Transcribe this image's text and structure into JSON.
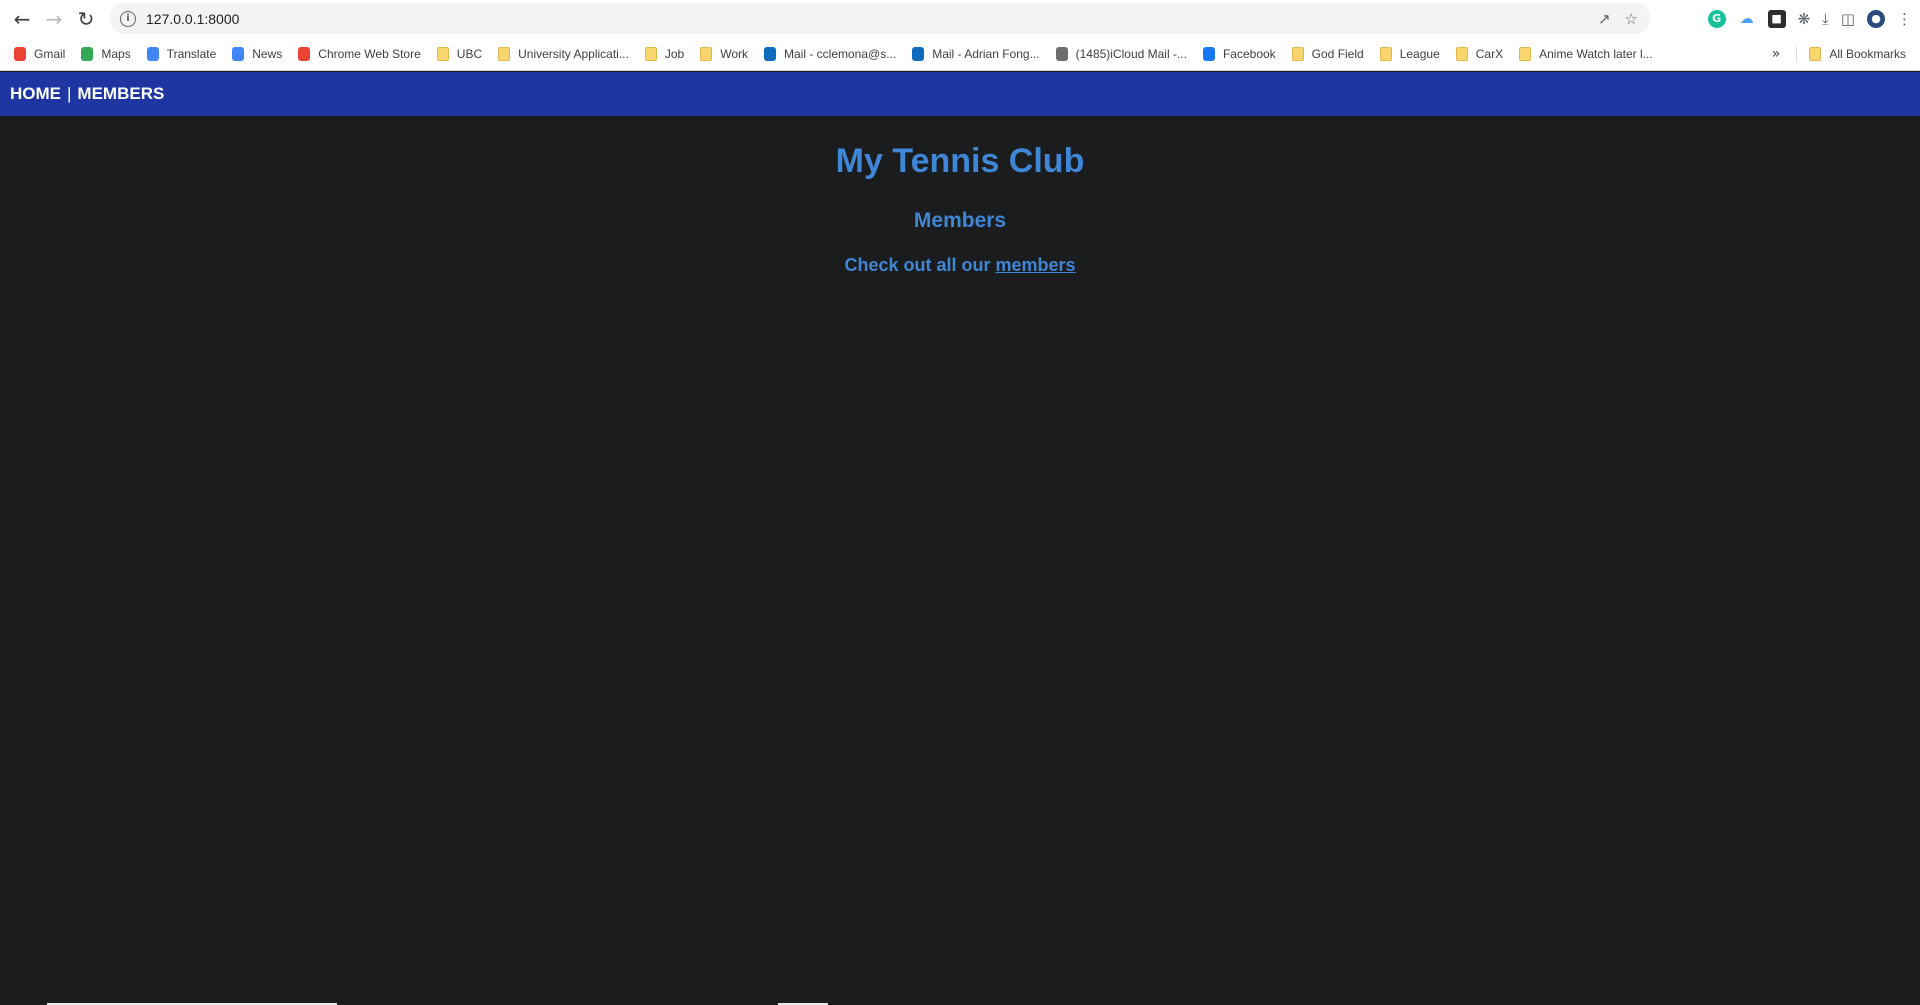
{
  "browser": {
    "url": "127.0.0.1:8000",
    "bookmarks": [
      {
        "label": "Gmail",
        "icon": "gmail-icon",
        "color": "#ea4335"
      },
      {
        "label": "Maps",
        "icon": "maps-icon",
        "color": "#34a853"
      },
      {
        "label": "Translate",
        "icon": "translate-icon",
        "color": "#4285f4"
      },
      {
        "label": "News",
        "icon": "news-icon",
        "color": "#4285f4"
      },
      {
        "label": "Chrome Web Store",
        "icon": "webstore-icon",
        "color": "#ea4335"
      },
      {
        "label": "UBC",
        "icon": "folder-icon",
        "color": "#f9d56e"
      },
      {
        "label": "University Applicati...",
        "icon": "folder-icon",
        "color": "#f9d56e"
      },
      {
        "label": "Job",
        "icon": "folder-icon",
        "color": "#f9d56e"
      },
      {
        "label": "Work",
        "icon": "folder-icon",
        "color": "#f9d56e"
      },
      {
        "label": "Mail - cclemona@s...",
        "icon": "outlook-icon",
        "color": "#0f6cbd"
      },
      {
        "label": "Mail - Adrian Fong...",
        "icon": "outlook-icon",
        "color": "#0f6cbd"
      },
      {
        "label": "(1485)iCloud Mail -...",
        "icon": "apple-icon",
        "color": "#6e6e6e"
      },
      {
        "label": "Facebook",
        "icon": "facebook-icon",
        "color": "#1877f2"
      },
      {
        "label": "God Field",
        "icon": "folder-icon",
        "color": "#f9d56e"
      },
      {
        "label": "League",
        "icon": "folder-icon",
        "color": "#f9d56e"
      },
      {
        "label": "CarX",
        "icon": "folder-icon",
        "color": "#f9d56e"
      },
      {
        "label": "Anime Watch later l...",
        "icon": "folder-icon",
        "color": "#f9d56e"
      }
    ],
    "all_bookmarks": "All Bookmarks"
  },
  "nav": {
    "home": "HOME",
    "separator": "|",
    "members": "MEMBERS",
    "bg_color": "#1f36a2"
  },
  "main": {
    "title": "My Tennis Club",
    "heading": "Members",
    "text": "Check out all our",
    "link": "members",
    "accent": "#3f86d6"
  }
}
